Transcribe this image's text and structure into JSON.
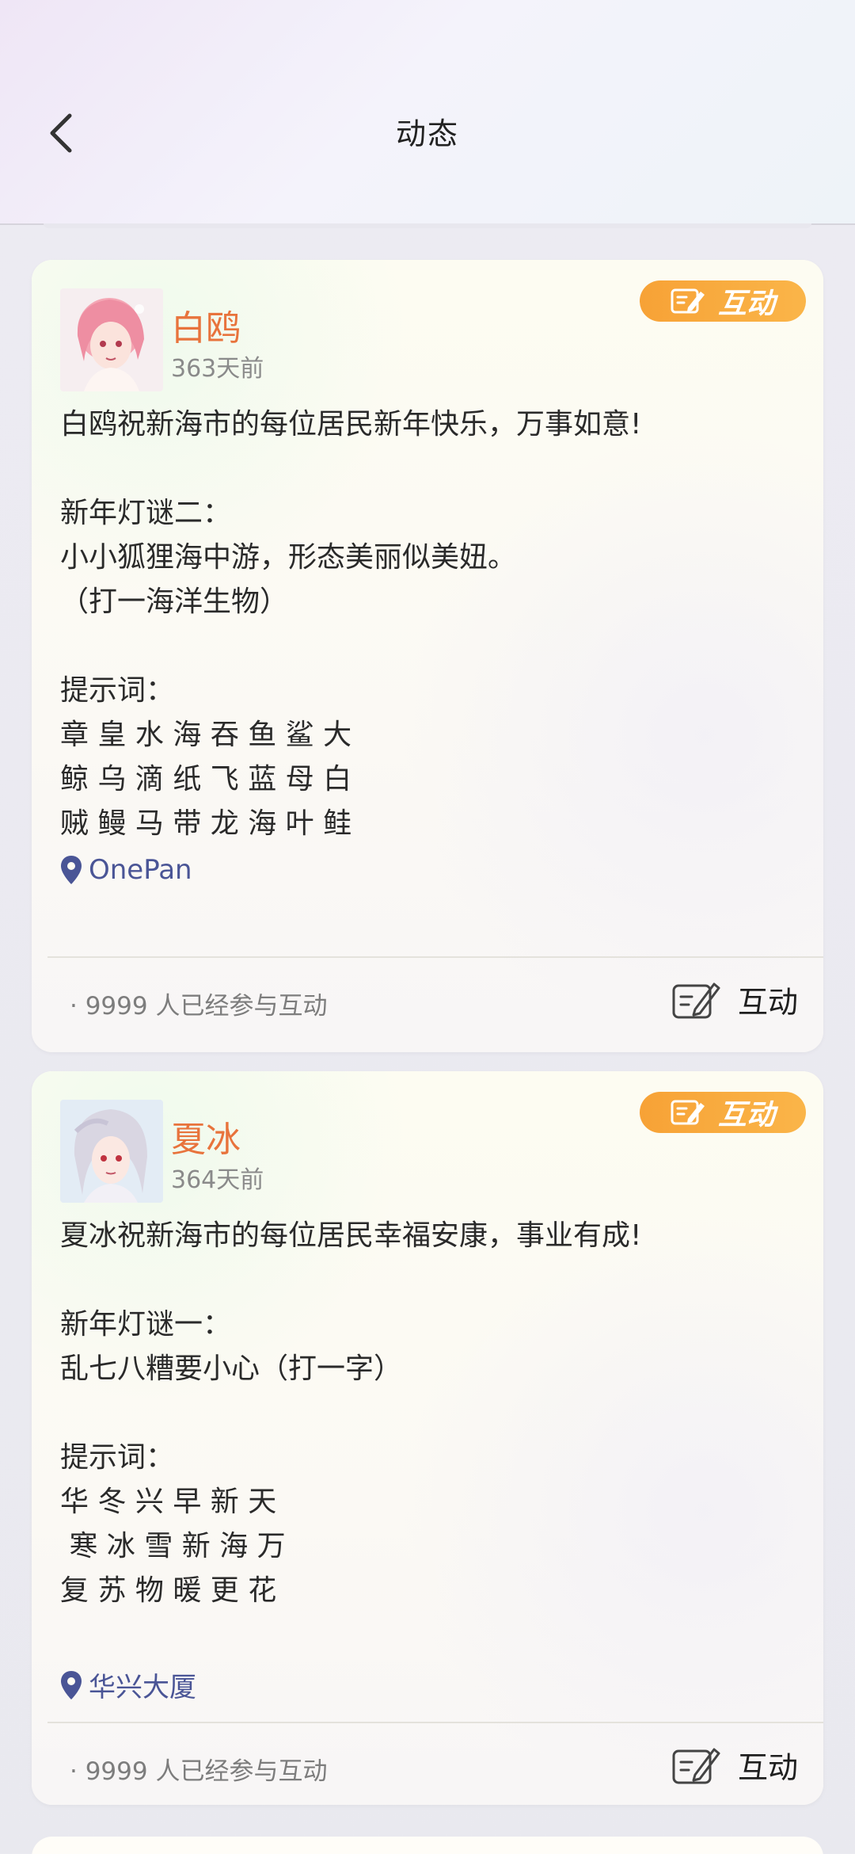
{
  "header": {
    "title": "动态",
    "back_icon": "chevron-left-icon"
  },
  "posts": [
    {
      "username": "白鸥",
      "time_ago": "363天前",
      "badge_label": "互动",
      "content": "白鸥祝新海市的每位居民新年快乐，万事如意!\n\n新年灯谜二：\n小小狐狸海中游，形态美丽似美妞。\n（打一海洋生物）\n\n提示词：\n章 皇 水 海 吞 鱼 鲨 大\n鲸 乌 滴 纸 飞 蓝 母 白\n贼 鳗 马 带 龙 海 叶 鲑",
      "location": "OnePan",
      "participants": "· 9999  人已经参与互动",
      "interact_label": "互动",
      "avatar_hair": "#f4a6b4"
    },
    {
      "username": "夏冰",
      "time_ago": "364天前",
      "badge_label": "互动",
      "content": "夏冰祝新海市的每位居民幸福安康，事业有成!\n\n新年灯谜一：\n乱七八糟要小心（打一字）\n\n提示词：\n华 冬 兴 早 新 天\n 寒 冰 雪 新 海 万\n复 苏 物 暖 更 花",
      "location": "华兴大厦",
      "participants": "· 9999  人已经参与互动",
      "interact_label": "互动",
      "avatar_hair": "#d9d6e2"
    }
  ],
  "colors": {
    "username": "#e8733c",
    "badge": "#f7a236",
    "location": "#4a5596"
  }
}
